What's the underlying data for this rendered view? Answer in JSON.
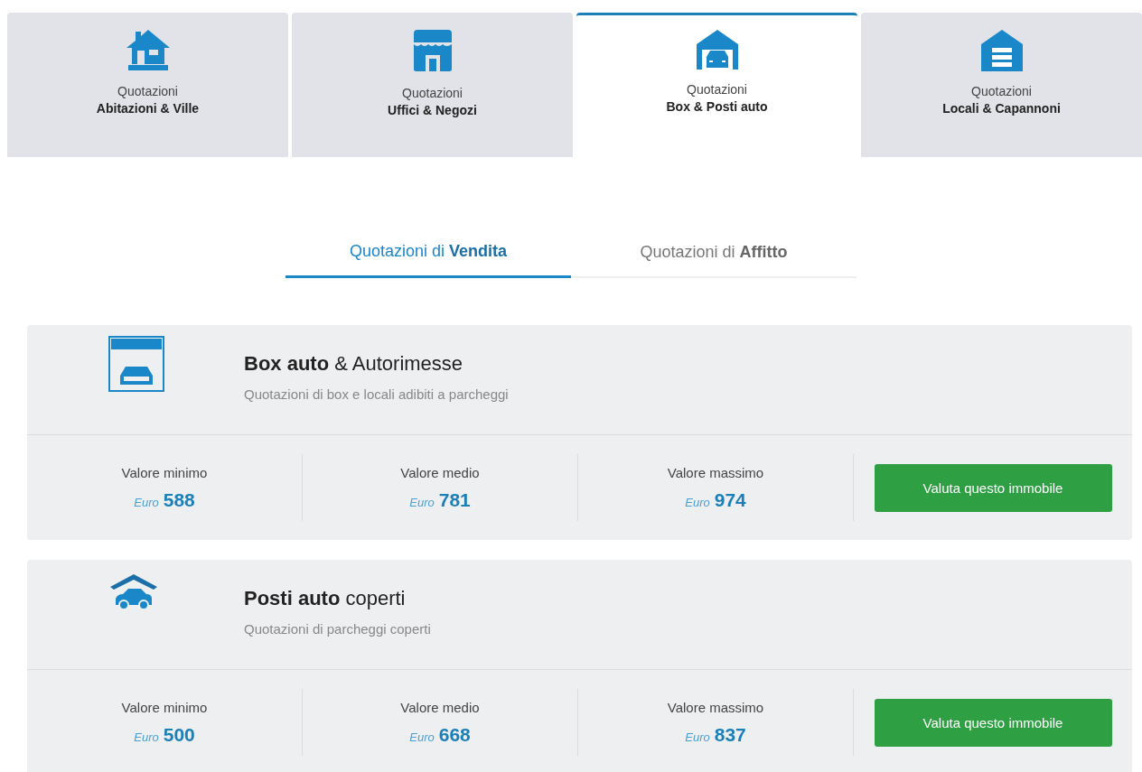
{
  "category_tabs": [
    {
      "kind": "house",
      "line_1": "Quotazioni",
      "line_2": "Abitazioni & Ville",
      "selected": false
    },
    {
      "kind": "shop",
      "line_1": "Quotazioni",
      "line_2": "Uffici & Negozi",
      "selected": false
    },
    {
      "kind": "garage",
      "line_1": "Quotazioni",
      "line_2": "Box & Posti auto",
      "selected": true
    },
    {
      "kind": "warehouse",
      "line_1": "Quotazioni",
      "line_2": "Locali & Capannoni",
      "selected": false
    }
  ],
  "mode_tabs": [
    {
      "label": "Quotazioni di **Vendita**",
      "selected": true
    },
    {
      "label": "Quotazioni di **Affitto**",
      "selected": false
    }
  ],
  "cards": [
    {
      "kind": "box",
      "title": "**Box auto** & Autorimesse",
      "subtitle": "Quotazioni di box e locali adibiti a parcheggi",
      "stats": [
        {
          "label": "Valore minimo",
          "currency": "Euro",
          "value": "588"
        },
        {
          "label": "Valore medio",
          "currency": "Euro",
          "value": "781"
        },
        {
          "label": "Valore massimo",
          "currency": "Euro",
          "value": "974"
        }
      ],
      "button": "Valuta questo immobile"
    },
    {
      "kind": "covered",
      "title": "**Posti auto** coperti",
      "subtitle": "Quotazioni di parcheggi coperti",
      "stats": [
        {
          "label": "Valore minimo",
          "currency": "Euro",
          "value": "500"
        },
        {
          "label": "Valore medio",
          "currency": "Euro",
          "value": "668"
        },
        {
          "label": "Valore massimo",
          "currency": "Euro",
          "value": "837"
        }
      ],
      "button": "Valuta questo immobile"
    }
  ]
}
